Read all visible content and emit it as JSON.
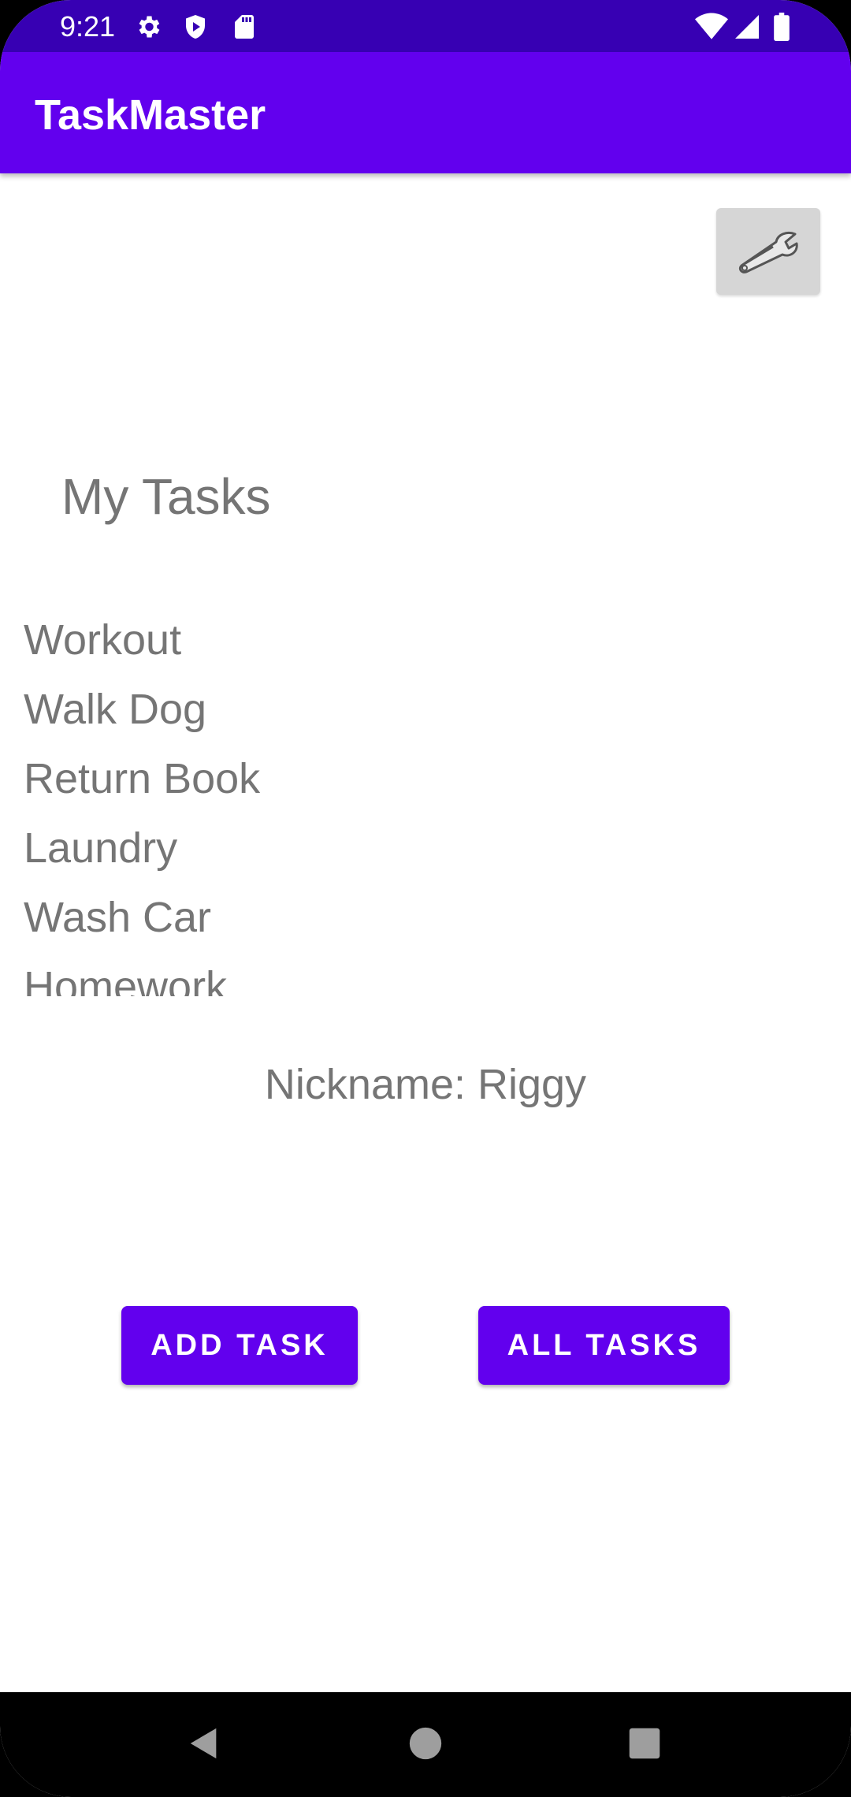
{
  "status_bar": {
    "time": "9:21",
    "background_color": "#3700b3",
    "icons": [
      "settings-gear-icon",
      "shield-play-icon",
      "sd-card-icon",
      "wifi-icon",
      "signal-icon",
      "battery-icon"
    ]
  },
  "app_bar": {
    "title": "TaskMaster",
    "background_color": "#6200ee"
  },
  "settings_button": {
    "icon": "wrench-icon"
  },
  "main": {
    "heading": "My Tasks",
    "tasks": [
      "Workout",
      "Walk Dog",
      "Return Book",
      "Laundry",
      "Wash Car",
      "Homework"
    ],
    "nickname": "Nickname: Riggy"
  },
  "buttons": {
    "add_task": "ADD TASK",
    "all_tasks": "ALL TASKS"
  },
  "nav_bar": {
    "icons": [
      "back-icon",
      "home-icon",
      "recents-icon"
    ]
  }
}
